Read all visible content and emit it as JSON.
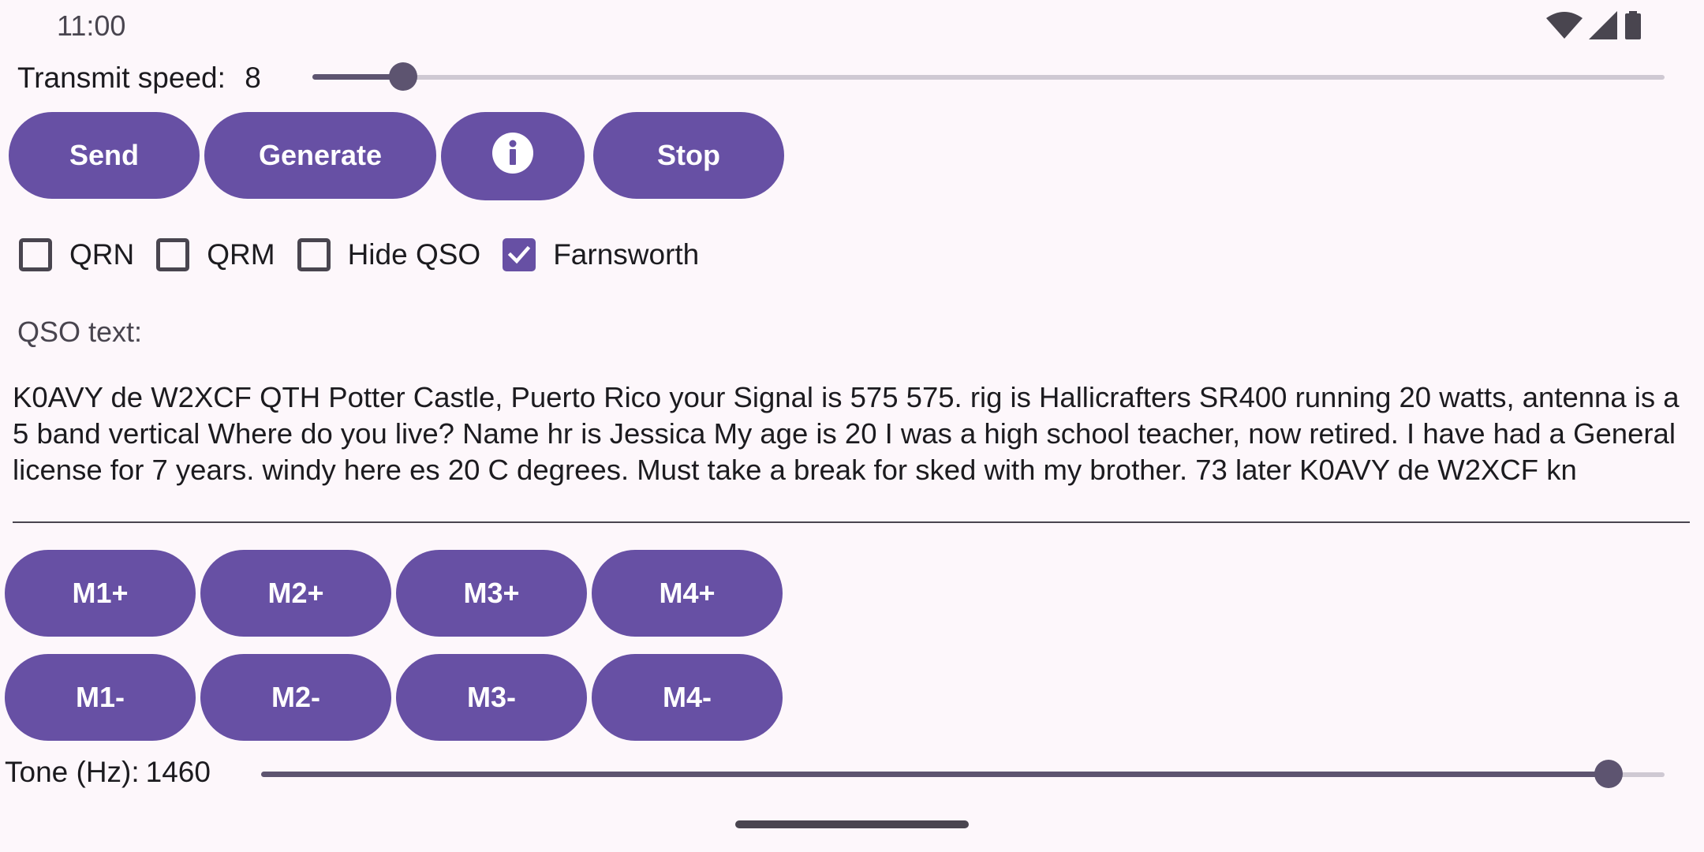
{
  "status_bar": {
    "time": "11:00",
    "icons": [
      "wifi-icon",
      "signal-icon",
      "battery-icon"
    ]
  },
  "transmit_speed": {
    "label": "Transmit speed:",
    "value": "8",
    "slider_fraction": 0.067
  },
  "controls": {
    "send_label": "Send",
    "generate_label": "Generate",
    "info_icon": "info-icon",
    "stop_label": "Stop"
  },
  "checkboxes": [
    {
      "label": "QRN",
      "checked": false
    },
    {
      "label": "QRM",
      "checked": false
    },
    {
      "label": "Hide QSO",
      "checked": false
    },
    {
      "label": "Farnsworth",
      "checked": true
    }
  ],
  "qso": {
    "label": "QSO text:",
    "text": "K0AVY de W2XCF QTH Potter Castle, Puerto Rico your Signal is 575 575. rig is Hallicrafters SR400 running 20 watts, antenna is a 5 band vertical Where do you live? Name hr is Jessica My age is 20 I was a high school teacher, now retired. I have had a General license for 7 years. windy here es 20 C degrees. Must take a break for sked with my brother. 73 later K0AVY de W2XCF kn"
  },
  "memory_buttons": {
    "row_plus": [
      "M1+",
      "M2+",
      "M3+",
      "M4+"
    ],
    "row_minus": [
      "M1-",
      "M2-",
      "M3-",
      "M4-"
    ]
  },
  "tone": {
    "label": "Tone (Hz):",
    "value": "1460",
    "slider_fraction": 0.96
  },
  "colors": {
    "primary": "#6750a4",
    "background": "#fdf7fb",
    "slider_active": "#5d5470",
    "slider_inactive": "#cfc9d3"
  }
}
